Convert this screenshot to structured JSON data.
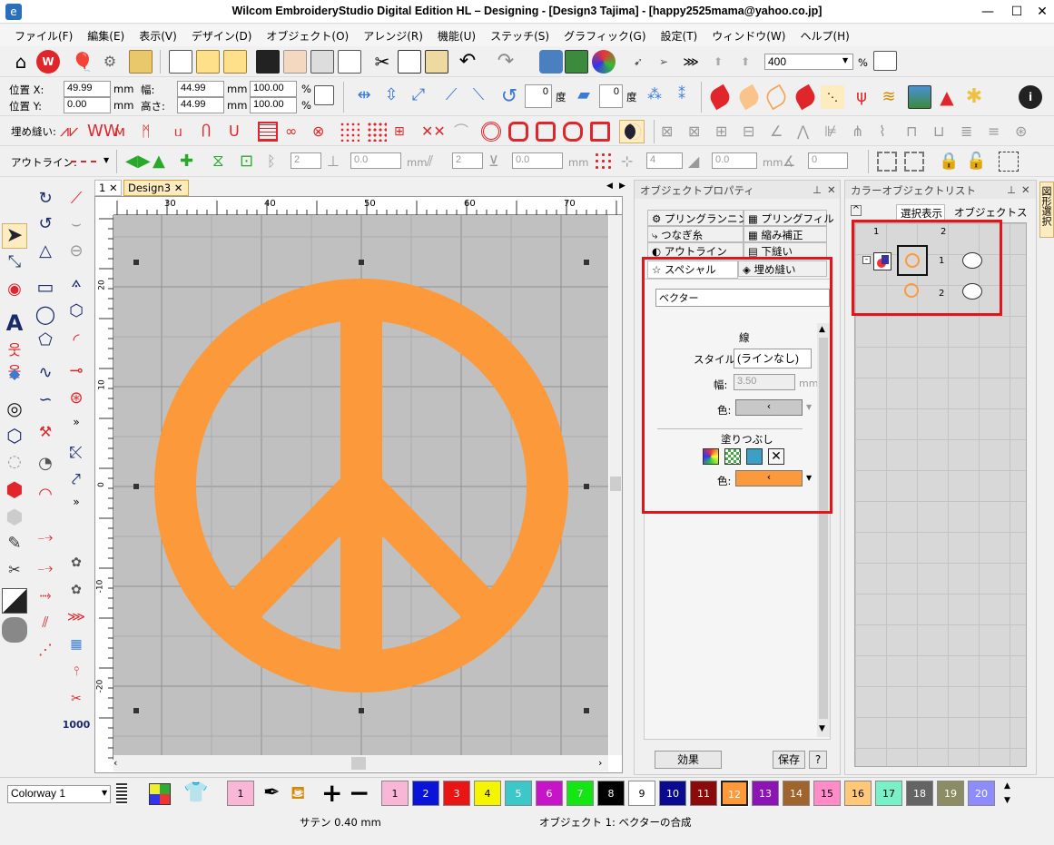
{
  "window": {
    "title": "Wilcom EmbroideryStudio Digital Edition HL – Designing - [Design3          Tajima] - [happy2525mama@yahoo.co.jp]"
  },
  "menu": [
    "ファイル(F)",
    "編集(E)",
    "表示(V)",
    "デザイン(D)",
    "オブジェクト(O)",
    "アレンジ(R)",
    "機能(U)",
    "ステッチ(S)",
    "グラフィック(G)",
    "設定(T)",
    "ウィンドウ(W)",
    "ヘルプ(H)"
  ],
  "toolbar": {
    "zoom": "400",
    "zoom_unit": "%"
  },
  "position": {
    "x_label": "位置 X:",
    "x_value": "49.99",
    "x_unit": "mm",
    "y_label": "位置 Y:",
    "y_value": "0.00",
    "y_unit": "mm",
    "w_label": "幅:",
    "w_value": "44.99",
    "w_unit": "mm",
    "w_pct": "100.00",
    "w_pct_unit": "%",
    "h_label": "高さ:",
    "h_value": "44.99",
    "h_unit": "mm",
    "h_pct": "100.00",
    "h_pct_unit": "%",
    "rotate_value": "0",
    "rotate_unit": "度",
    "skew_value": "0",
    "skew_unit": "度"
  },
  "fill_toolbar": {
    "label": "埋め縫い:"
  },
  "outline_toolbar": {
    "label": "アウトライン:",
    "v1": "2",
    "v2": "0.0",
    "unit1": "mm",
    "v3": "2",
    "v4": "0.0",
    "unit2": "mm",
    "v5": "4",
    "v6": "0.0",
    "unit3": "mm",
    "v7": "0"
  },
  "doc_tabs": [
    {
      "label": "1"
    },
    {
      "label": "Design3"
    }
  ],
  "ruler": {
    "top": [
      "30",
      "40",
      "50",
      "60",
      "70"
    ],
    "left": [
      "20",
      "10",
      "0",
      "-10",
      "-20"
    ]
  },
  "properties": {
    "title": "オブジェクトプロパティ",
    "tabs_row1": [
      "プリングランニング",
      "プリングフィル"
    ],
    "tabs_row2": [
      "つなぎ糸",
      "縮み補正"
    ],
    "tabs_row3": [
      "アウトライン",
      "下縫い"
    ],
    "tabs_row4": [
      "スペシャル",
      "埋め縫い"
    ],
    "object_type": "ベクター",
    "line_section": "線",
    "style_label": "スタイル:",
    "style_value": "(ラインなし)",
    "width_label": "幅:",
    "width_value": "3.50",
    "width_unit": "mm",
    "color_label": "色:",
    "fill_section": "塗りつぶし",
    "fill_color_label": "色:",
    "effects_btn": "効果",
    "save_btn": "保存",
    "help_btn": "?"
  },
  "colorlist": {
    "title": "カラーオブジェクトリスト",
    "tab_selected": "選択表示",
    "tab_status": "オブジェクトステータス",
    "col1": "1",
    "col2": "2",
    "row1_num": "1",
    "row2_num": "2"
  },
  "side_tab": "図形選択",
  "colorway": {
    "value": "Colorway 1"
  },
  "current_color": "1",
  "palette": [
    {
      "n": "1",
      "c": "#f9b6d6"
    },
    {
      "n": "2",
      "c": "#0a14d8"
    },
    {
      "n": "3",
      "c": "#ea1414"
    },
    {
      "n": "4",
      "c": "#f5f500"
    },
    {
      "n": "5",
      "c": "#3cc8c8"
    },
    {
      "n": "6",
      "c": "#c814c8"
    },
    {
      "n": "7",
      "c": "#14e614"
    },
    {
      "n": "8",
      "c": "#000000"
    },
    {
      "n": "9",
      "c": "#ffffff"
    },
    {
      "n": "10",
      "c": "#0a0a90"
    },
    {
      "n": "11",
      "c": "#8c0a0a"
    },
    {
      "n": "12",
      "c": "#ff9a3c"
    },
    {
      "n": "13",
      "c": "#8c14b4"
    },
    {
      "n": "14",
      "c": "#a0642d"
    },
    {
      "n": "15",
      "c": "#ff8cc8"
    },
    {
      "n": "16",
      "c": "#ffc878"
    },
    {
      "n": "17",
      "c": "#78f0c8"
    },
    {
      "n": "18",
      "c": "#646464"
    },
    {
      "n": "19",
      "c": "#8c8c64"
    },
    {
      "n": "20",
      "c": "#8c8cff"
    }
  ],
  "status": {
    "left": "サテン  0.40 mm",
    "center": "オブジェクト 1: ベクターの合成"
  },
  "colors": {
    "accent_orange": "#fc993a",
    "red_highlight": "#e3151a"
  }
}
